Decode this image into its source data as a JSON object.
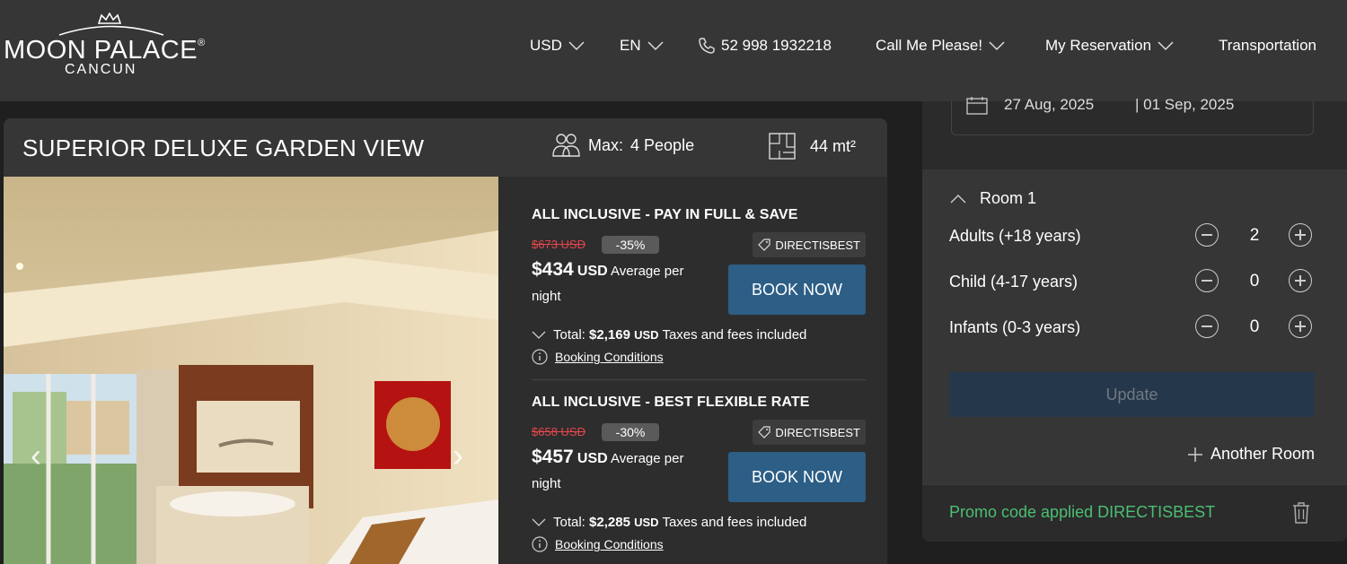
{
  "header": {
    "brand_name": "MOON PALACE",
    "brand_mark": "®",
    "brand_sub": "CANCUN",
    "currency": "USD",
    "language": "EN",
    "phone": "52 998 1932218",
    "call_me": "Call Me Please!",
    "my_reservation": "My Reservation",
    "transportation": "Transportation"
  },
  "room": {
    "title": "SUPERIOR DELUXE GARDEN VIEW",
    "max_label": "Max:",
    "max_value": "4 People",
    "size": "44 mt²"
  },
  "rates": [
    {
      "name": "ALL INCLUSIVE - PAY IN FULL & SAVE",
      "old_price": "$673 USD",
      "discount": "-35%",
      "promo": "DIRECTISBEST",
      "price": "$434",
      "currency": "USD",
      "per_night": "Average per night",
      "book": "BOOK NOW",
      "total_label": "Total:",
      "total_value": "$2,169",
      "total_currency": "USD",
      "taxes": "Taxes and fees included",
      "conditions": "Booking Conditions"
    },
    {
      "name": "ALL INCLUSIVE - BEST FLEXIBLE RATE",
      "old_price": "$658 USD",
      "discount": "-30%",
      "promo": "DIRECTISBEST",
      "price": "$457",
      "currency": "USD",
      "per_night": "Average per night",
      "book": "BOOK NOW",
      "total_label": "Total:",
      "total_value": "$2,285",
      "total_currency": "USD",
      "taxes": "Taxes and fees included",
      "conditions": "Booking Conditions"
    }
  ],
  "panel": {
    "check_in": "27 Aug, 2025",
    "check_out": "| 01 Sep, 2025",
    "room_label": "Room 1",
    "occupancy": [
      {
        "label": "Adults (+18 years)",
        "value": "2"
      },
      {
        "label": "Child (4-17 years)",
        "value": "0"
      },
      {
        "label": "Infants (0-3 years)",
        "value": "0"
      }
    ],
    "update": "Update",
    "another_room": "Another Room",
    "promo_applied": "Promo code applied DIRECTISBEST"
  },
  "colors": {
    "header_bg": "#363636",
    "book_button": "#2c5e86",
    "promo_green": "#4cbf73",
    "old_price_red": "#e4464c"
  }
}
